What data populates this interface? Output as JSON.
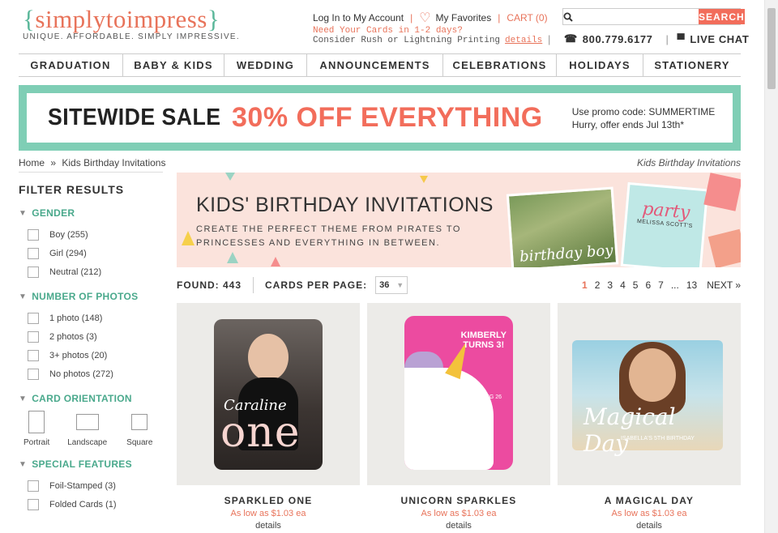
{
  "brand": {
    "name": "simplytoimpress",
    "tagline": "UNIQUE. AFFORDABLE. SIMPLY IMPRESSIVE."
  },
  "toplinks": {
    "account": "Log In to My Account",
    "favorites": "My Favorites",
    "cart": "CART (0)"
  },
  "rush": {
    "line1": "Need Your Cards in 1-2 days?",
    "line2": "Consider Rush or Lightning Printing",
    "details": "details"
  },
  "search": {
    "placeholder": "",
    "button": "SEARCH"
  },
  "contact": {
    "phone": "800.779.6177",
    "chat": "LIVE CHAT"
  },
  "nav": [
    "GRADUATION",
    "BABY & KIDS",
    "WEDDING",
    "ANNOUNCEMENTS",
    "CELEBRATIONS",
    "HOLIDAYS",
    "STATIONERY"
  ],
  "sale": {
    "left": "SITEWIDE SALE",
    "middle": "30% OFF EVERYTHING",
    "promo": "Use promo code: SUMMERTIME",
    "ends": "Hurry, offer ends Jul 13th*"
  },
  "breadcrumb": {
    "home": "Home",
    "sep": "»",
    "current": "Kids Birthday Invitations",
    "right": "Kids Birthday Invitations"
  },
  "filters": {
    "title": "FILTER RESULTS",
    "gender": {
      "heading": "GENDER",
      "options": [
        "Boy (255)",
        "Girl (294)",
        "Neutral (212)"
      ]
    },
    "photos": {
      "heading": "NUMBER OF PHOTOS",
      "options": [
        "1 photo (148)",
        "2 photos (3)",
        "3+ photos (20)",
        "No photos (272)"
      ]
    },
    "orientation": {
      "heading": "CARD ORIENTATION",
      "options": [
        "Portrait",
        "Landscape",
        "Square"
      ]
    },
    "features": {
      "heading": "SPECIAL FEATURES",
      "options": [
        "Foil-Stamped (3)",
        "Folded Cards (1)"
      ]
    }
  },
  "hero": {
    "title": "KIDS' BIRTHDAY INVITATIONS",
    "sub1": "CREATE THE PERFECT THEME FROM PIRATES TO",
    "sub2": "PRINCESSES AND EVERYTHING IN BETWEEN.",
    "photo_caption": "birthday boy",
    "card_word": "party",
    "card_name": "MELISSA SCOTT'S"
  },
  "results": {
    "found": "FOUND: 443",
    "per_page_label": "CARDS PER PAGE:",
    "per_page_value": "36",
    "pages": [
      "1",
      "2",
      "3",
      "4",
      "5",
      "6",
      "7",
      "...",
      "13"
    ],
    "current_page": "1",
    "next": "NEXT »"
  },
  "products": [
    {
      "name": "SPARKLED ONE",
      "price": "As low as $1.03 ea",
      "details": "details",
      "art_big": "one",
      "art_script": "Caraline"
    },
    {
      "name": "UNICORN SPARKLES",
      "price": "As low as $1.03 ea",
      "details": "details",
      "art_line1": "KIMBERLY",
      "art_line2": "TURNS 3!",
      "art_date": "SATURDAY AUG 26",
      "art_time": "1-3 PM"
    },
    {
      "name": "A MAGICAL DAY",
      "price": "As low as $1.03 ea",
      "details": "details",
      "art_script": "Magical Day",
      "art_sub": "ISABELLA'S 5TH BIRTHDAY"
    }
  ],
  "colors": {
    "accent": "#f26d5b",
    "teal": "#7fceb5",
    "filter_heading": "#4aa98c"
  }
}
